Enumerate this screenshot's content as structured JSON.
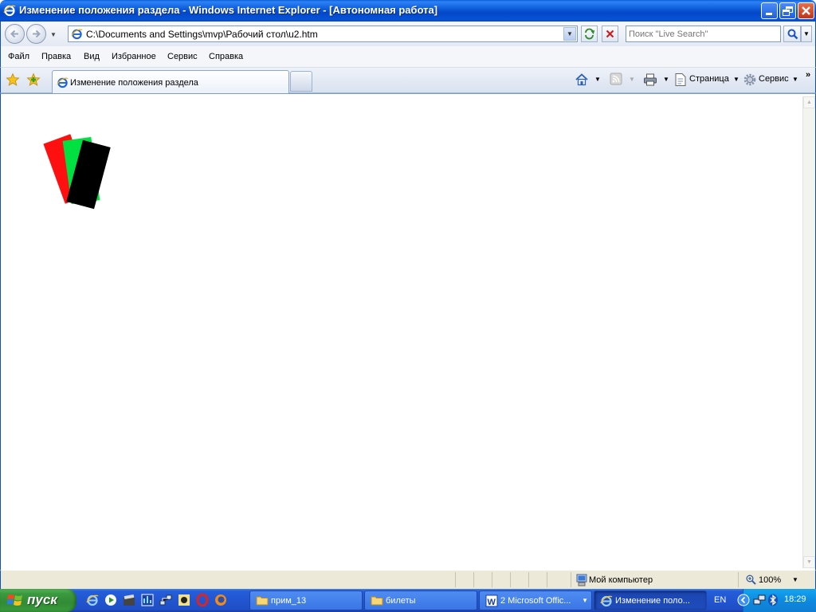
{
  "window": {
    "title": "Изменение положения раздела - Windows Internet Explorer - [Автономная работа]"
  },
  "address": {
    "url": "C:\\Documents and Settings\\mvp\\Рабочий стол\\u2.htm"
  },
  "search": {
    "placeholder": "Поиск \"Live Search\""
  },
  "menu": {
    "items": [
      "Файл",
      "Правка",
      "Вид",
      "Избранное",
      "Сервис",
      "Справка"
    ]
  },
  "tabs": {
    "active_label": "Изменение положения раздела"
  },
  "commandbar": {
    "page_label": "Страница",
    "tools_label": "Сервис",
    "chevron": "»"
  },
  "content": {
    "sections": [
      {
        "name": "red",
        "color": "#ff1010"
      },
      {
        "name": "green",
        "color": "#00e040"
      },
      {
        "name": "black",
        "color": "#000000"
      }
    ]
  },
  "statusbar": {
    "zone": "Мой компьютер",
    "zoom": "100%"
  },
  "taskbar": {
    "start_label": "пуск",
    "buttons": [
      {
        "label": "прим_13",
        "icon": "folder-icon"
      },
      {
        "label": "билеты",
        "icon": "folder-icon"
      },
      {
        "label": "2 Microsoft Offic...",
        "icon": "word-icon"
      },
      {
        "label": "Изменение поло...",
        "icon": "ie-icon"
      }
    ],
    "language": "EN",
    "clock": "18:29"
  }
}
